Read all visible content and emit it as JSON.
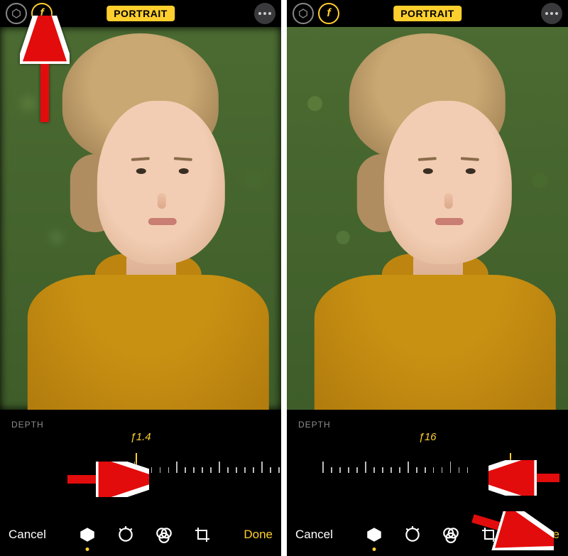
{
  "left": {
    "mode_badge": "PORTRAIT",
    "depth_label": "DEPTH",
    "f_value": "ƒ1.4",
    "slider_position_percent": 48,
    "cancel_label": "Cancel",
    "done_label": "Done",
    "background_blur": true
  },
  "right": {
    "mode_badge": "PORTRAIT",
    "depth_label": "DEPTH",
    "f_value": "ƒ16",
    "slider_position_percent": 82,
    "cancel_label": "Cancel",
    "done_label": "Done",
    "background_blur": false
  },
  "icons": {
    "lighting": "hexagon-icon",
    "aperture": "f-icon",
    "more": "ellipsis-icon",
    "tool_cube": "cube-icon",
    "tool_dial": "dial-icon",
    "tool_filters": "filters-icon",
    "tool_crop": "crop-icon"
  },
  "annotations": {
    "arrow_top_to_f_button": true,
    "arrow_left_to_slider_left": true,
    "arrow_right_to_slider_right": true,
    "arrow_right_to_done": true
  }
}
